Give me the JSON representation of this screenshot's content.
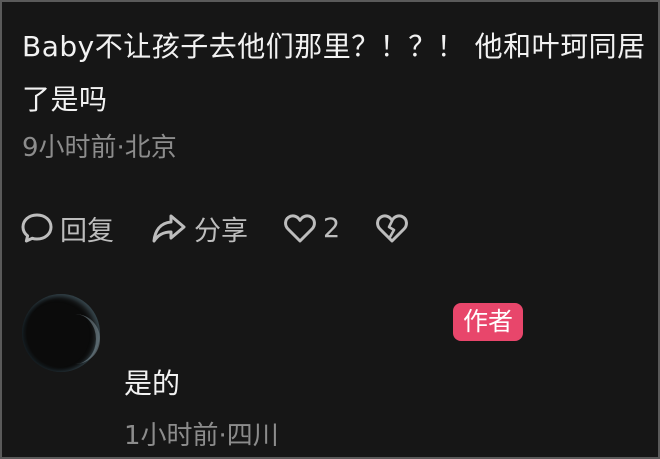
{
  "comment": {
    "text": "Baby不让孩子去他们那里？！？！ 他和叶珂同居了是吗",
    "meta": "9小时前·北京"
  },
  "actions": {
    "reply_label": "回复",
    "share_label": "分享",
    "like_count": "2",
    "icons": {
      "reply": "comment-bubble-icon",
      "share": "share-arrow-icon",
      "like": "heart-outline-icon",
      "dislike": "broken-heart-icon"
    }
  },
  "reply": {
    "badge": "作者",
    "text": "是的",
    "meta": "1小时前·四川"
  },
  "colors": {
    "background": "#161616",
    "text": "#f2f2f2",
    "muted": "#8c8c8c",
    "badge": "#e8466b"
  }
}
